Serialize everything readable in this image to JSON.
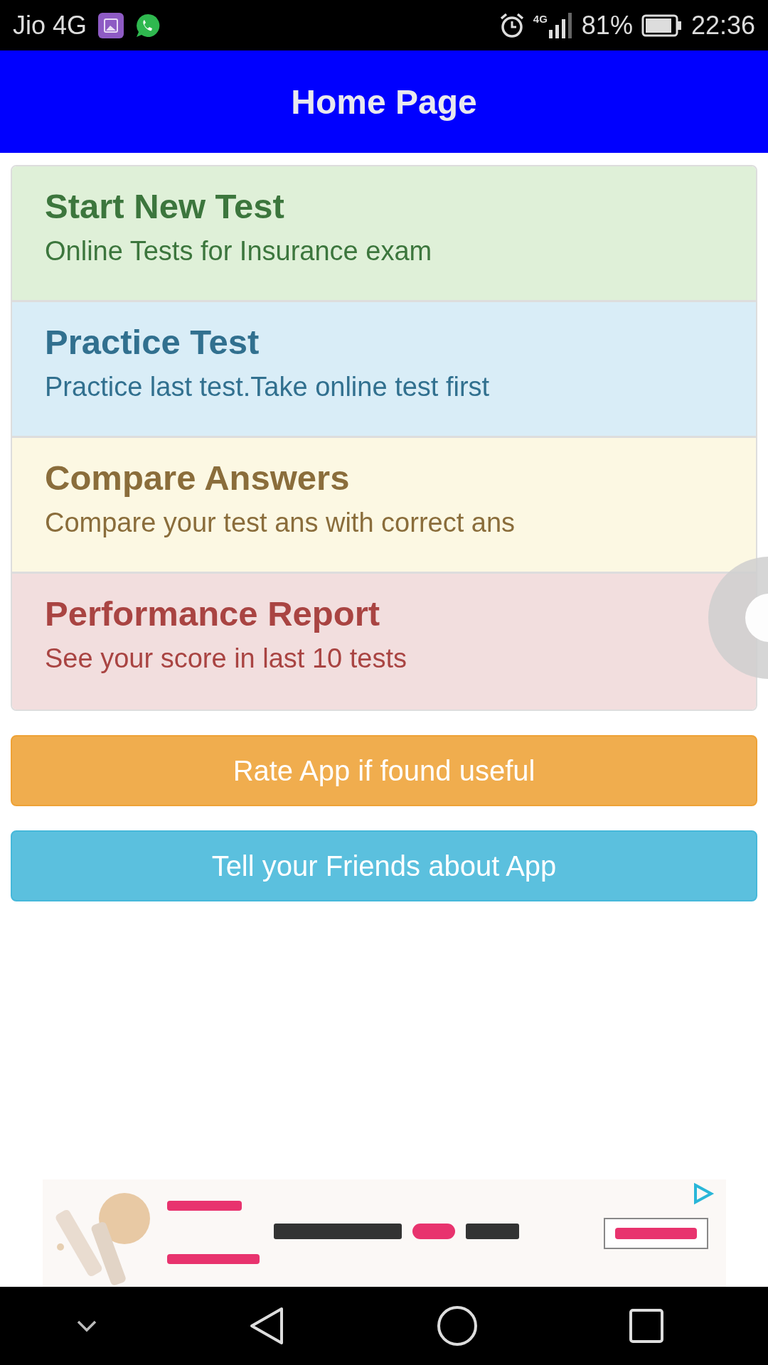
{
  "status_bar": {
    "carrier": "Jio 4G",
    "network_type": "4G",
    "battery": "81%",
    "time": "22:36"
  },
  "header": {
    "title": "Home Page"
  },
  "menu": [
    {
      "kind": "success",
      "title": "Start New Test",
      "subtitle": "Online Tests for Insurance exam"
    },
    {
      "kind": "info",
      "title": "Practice Test",
      "subtitle": "Practice last test.Take online test first"
    },
    {
      "kind": "warning",
      "title": "Compare Answers",
      "subtitle": "Compare your test ans with correct ans"
    },
    {
      "kind": "danger",
      "title": "Performance Report",
      "subtitle": "See your score in last 10 tests"
    }
  ],
  "buttons": [
    {
      "kind": "warning",
      "label": "Rate App if found useful"
    },
    {
      "kind": "info",
      "label": "Tell your Friends about App"
    }
  ]
}
